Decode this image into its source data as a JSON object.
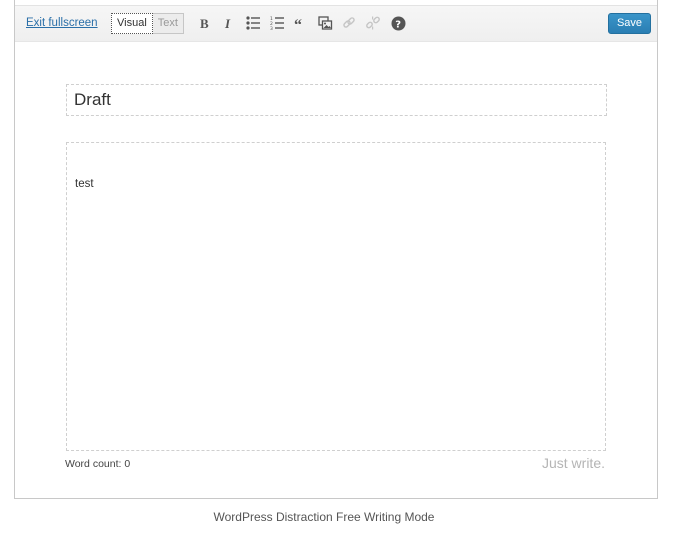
{
  "toolbar": {
    "exit_label": "Exit fullscreen",
    "modes": [
      {
        "label": "Visual",
        "active": true
      },
      {
        "label": "Text",
        "active": false
      }
    ],
    "tools": [
      {
        "name": "bold-icon",
        "enabled": true
      },
      {
        "name": "italic-icon",
        "enabled": true
      },
      {
        "name": "bulleted-list-icon",
        "enabled": true
      },
      {
        "name": "numbered-list-icon",
        "enabled": true
      },
      {
        "name": "blockquote-icon",
        "enabled": true
      },
      {
        "name": "add-media-icon",
        "enabled": true
      },
      {
        "name": "insert-link-icon",
        "enabled": false
      },
      {
        "name": "remove-link-icon",
        "enabled": false
      },
      {
        "name": "help-icon",
        "enabled": true
      }
    ],
    "save_label": "Save"
  },
  "editor": {
    "title_value": "Draft",
    "content_text": "test"
  },
  "footer": {
    "word_count_label": "Word count:",
    "word_count_value": "0",
    "tagline": "Just write."
  },
  "caption": "WordPress Distraction Free Writing Mode",
  "colors": {
    "link": "#2a6fa8",
    "save_button": "#2a7eb3",
    "tagline": "#b5b5b5"
  }
}
